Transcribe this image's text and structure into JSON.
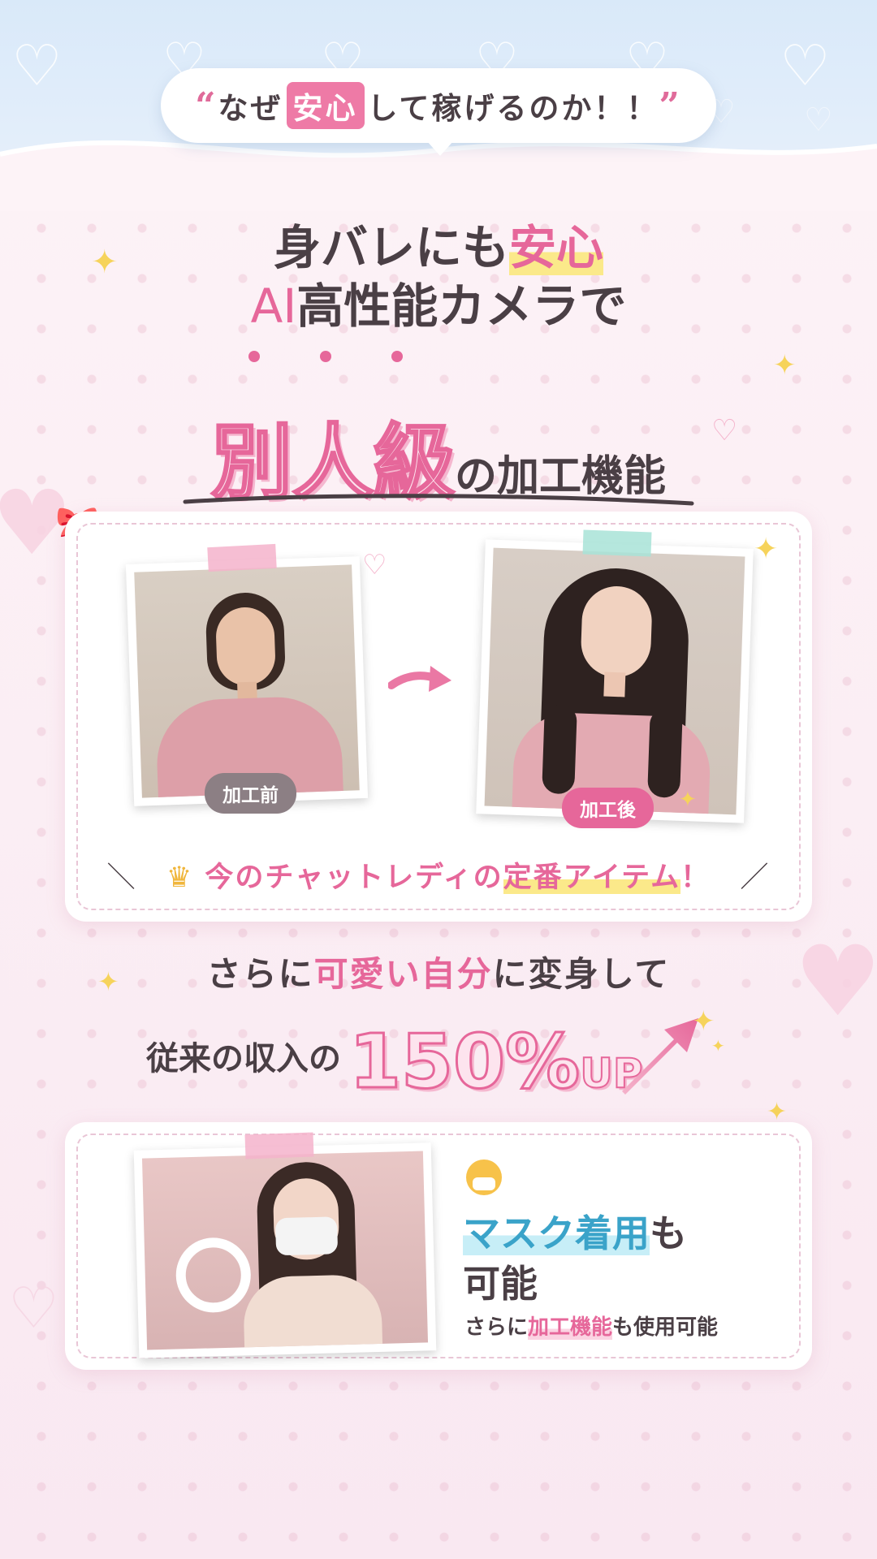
{
  "header": {
    "quote_open": "“",
    "text_before": "なぜ",
    "text_highlight": "安心",
    "text_after": "して稼げるのか！！",
    "quote_close": "”"
  },
  "headline": {
    "line1_text": "身バレにも",
    "line1_highlight": "安心",
    "line2_ai": "AI",
    "line2_text": "高性能カメラで"
  },
  "feature": {
    "big_text": "別人級",
    "rest_text": "の加工機能"
  },
  "comparison": {
    "before_label": "加工前",
    "after_label": "加工後",
    "footer_icon": "crown-icon",
    "footer_text": "今のチャットレディの",
    "footer_highlight": "定番アイテム",
    "footer_end": "！",
    "slash_left": "＼",
    "slash_right": "／"
  },
  "promo": {
    "line1_prefix": "さらに",
    "line1_highlight": "可愛い自分",
    "line1_suffix": "に変身して",
    "line2_prefix": "従来の収入の",
    "line2_number": "150%",
    "line2_suffix": "UP"
  },
  "mask_card": {
    "emoji_icon": "mask-face-emoji-icon",
    "title_highlight": "マスク着用",
    "title_rest": "も",
    "title_line2": "可能",
    "sub_prefix": "さらに",
    "sub_highlight": "加工機能",
    "sub_suffix": "も使用可能"
  },
  "colors": {
    "accent_pink": "#e6679a",
    "highlight_yellow": "#fbe98a",
    "accent_blue": "#3aa3c9",
    "top_band": "#d9e9f9"
  }
}
